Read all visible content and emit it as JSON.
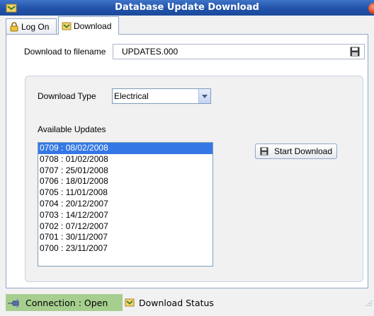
{
  "window": {
    "title": "Database Update Download"
  },
  "tabs": [
    {
      "label": "Log On",
      "icon": "lock-icon"
    },
    {
      "label": "Download",
      "icon": "folder-icon"
    }
  ],
  "download": {
    "filename_label": "Download to filename",
    "filename_value": "UPDATES.000",
    "type_label": "Download Type",
    "type_value": "Electrical",
    "available_label": "Available Updates",
    "updates": [
      "0709 : 08/02/2008",
      "0708 : 01/02/2008",
      "0707 : 25/01/2008",
      "0706 : 18/01/2008",
      "0705 : 11/01/2008",
      "0704 : 20/12/2007",
      "0703 : 14/12/2007",
      "0702 : 07/12/2007",
      "0701 : 30/11/2007",
      "0700 : 23/11/2007"
    ],
    "selected_index": 0,
    "start_button": "Start Download"
  },
  "status": {
    "connection": "Connection : Open",
    "download_status": "Download Status"
  },
  "colors": {
    "title_bar": "#2152a8",
    "selection": "#3478e6",
    "connection_bg": "#a6ce8e"
  }
}
